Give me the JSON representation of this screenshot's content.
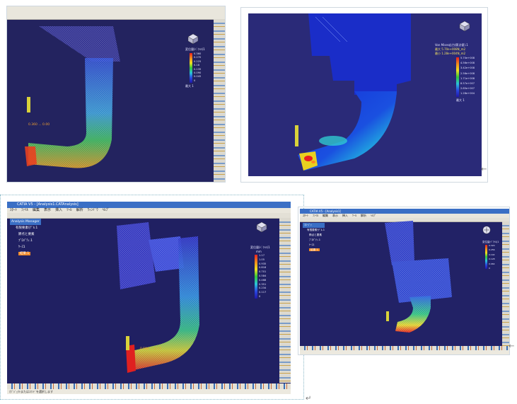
{
  "panels": [
    {
      "id": "top-left",
      "legend_title": "変位量(ﾍﾞｸﾄﾙ)1",
      "legend_ticks": [
        "0.360",
        "0.270",
        "0.225",
        "0.18",
        "0.135",
        "0.090",
        "0.045",
        "0"
      ],
      "legend_footer": "最大 1",
      "annotation": "0.360 ... 0.00"
    },
    {
      "id": "top-right",
      "legend_title": "Von Mises応力(節点値).1",
      "legend_header_lines": [
        "最大 5.70e+008N_m2",
        "最小 1.28e+004N_m2"
      ],
      "legend_ticks": [
        "5.70e+008",
        "4.56e+008",
        "3.42e+008",
        "2.56e+008",
        "1.71e+008",
        "8.57e+007",
        "2.85e+007",
        "1.28e+004"
      ],
      "legend_footer": "最大 1"
    },
    {
      "id": "bottom-left",
      "title": "CATIA V5 - [Analysis1.CATAnalysis]",
      "menu": [
        "ｽﾀｰﾄ",
        "ﾌｧｲﾙ",
        "編集",
        "表示",
        "挿入",
        "ﾂｰﾙ",
        "解析",
        "ｳｨﾝﾄﾞｳ",
        "ﾍﾙﾌﾟ"
      ],
      "tree": [
        "Analysis Manager",
        "有限要素ﾓﾃﾞﾙ.1",
        "節点と要素",
        "ﾌﾟﾛﾊﾟﾃｨ.1",
        "ｹｰｽ1",
        "結果.1"
      ],
      "legend_title": "変位量(ﾍﾞｸﾄﾙ)1",
      "legend_unit": "mm",
      "legend_ticks": [
        "1.17",
        "1.05",
        "0.935",
        "0.818",
        "0.701",
        "0.584",
        "0.468",
        "0.351",
        "0.234",
        "0.117",
        "0"
      ],
      "annotation": "0.584 ... 1.17",
      "status": "ｵﾌﾞｼﾞｪｸﾄまたはｺﾏﾝﾄﾞを選択します"
    },
    {
      "id": "bottom-right",
      "title": "CATIA V5 - [Analysis1]",
      "menu": [
        "ｽﾀｰﾄ",
        "ﾌｧｲﾙ",
        "編集",
        "表示",
        "挿入",
        "ﾂｰﾙ",
        "解析",
        "ﾍﾙﾌﾟ"
      ],
      "tree": [
        "ﾏﾈｰｼﾞｬ",
        "有限要素ﾓﾃﾞﾙ.1",
        "節点と要素",
        "ﾌﾟﾛﾊﾟﾃｨ.1",
        "ｹｰｽ1",
        "結果.1"
      ],
      "legend_title": "変位量(ﾍﾞｸﾄﾙ)1",
      "legend_ticks": [
        "0.320",
        "0.256",
        "0.192",
        "0.128",
        "0.064",
        "0"
      ]
    }
  ],
  "return_mark": "←",
  "paragraph_mark": "↵"
}
